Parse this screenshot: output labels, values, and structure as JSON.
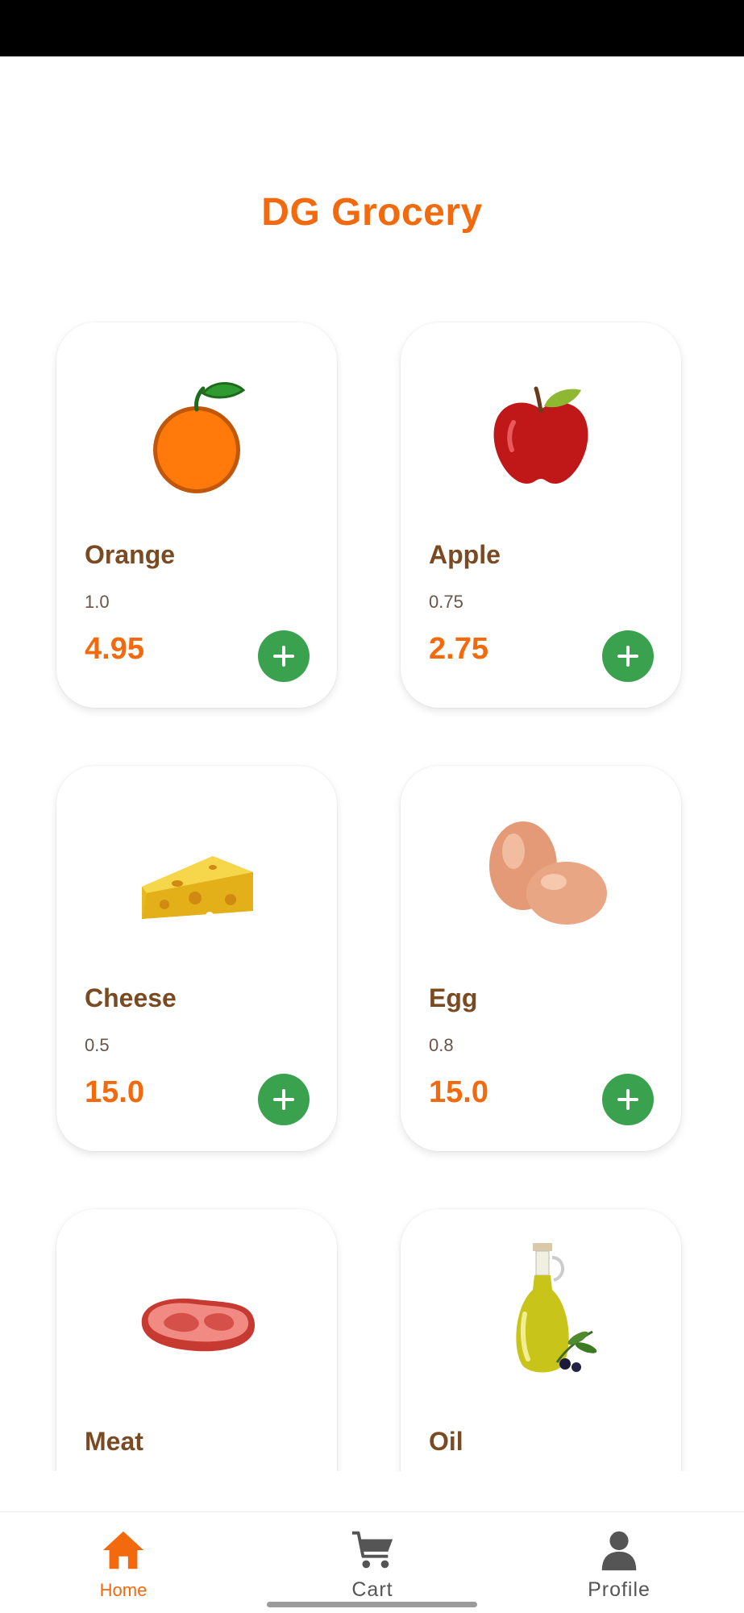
{
  "app": {
    "title": "DG Grocery"
  },
  "products": [
    {
      "name": "Orange",
      "quantity": "1.0",
      "price": "4.95",
      "icon": "orange-image"
    },
    {
      "name": "Apple",
      "quantity": "0.75",
      "price": "2.75",
      "icon": "apple-image"
    },
    {
      "name": "Cheese",
      "quantity": "0.5",
      "price": "15.0",
      "icon": "cheese-image"
    },
    {
      "name": "Egg",
      "quantity": "0.8",
      "price": "15.0",
      "icon": "egg-image"
    },
    {
      "name": "Meat",
      "icon": "meat-image"
    },
    {
      "name": "Oil",
      "icon": "oil-image"
    }
  ],
  "add_icon": "plus-icon",
  "nav": {
    "items": [
      {
        "label": "Home",
        "icon": "home-icon",
        "active": true
      },
      {
        "label": "Cart",
        "icon": "cart-icon",
        "active": false
      },
      {
        "label": "Profile",
        "icon": "person-icon",
        "active": false
      }
    ]
  },
  "colors": {
    "accent": "#f26a0d",
    "product_name": "#7a4a22",
    "add_button": "#3aa14f",
    "nav_inactive": "#555555"
  }
}
